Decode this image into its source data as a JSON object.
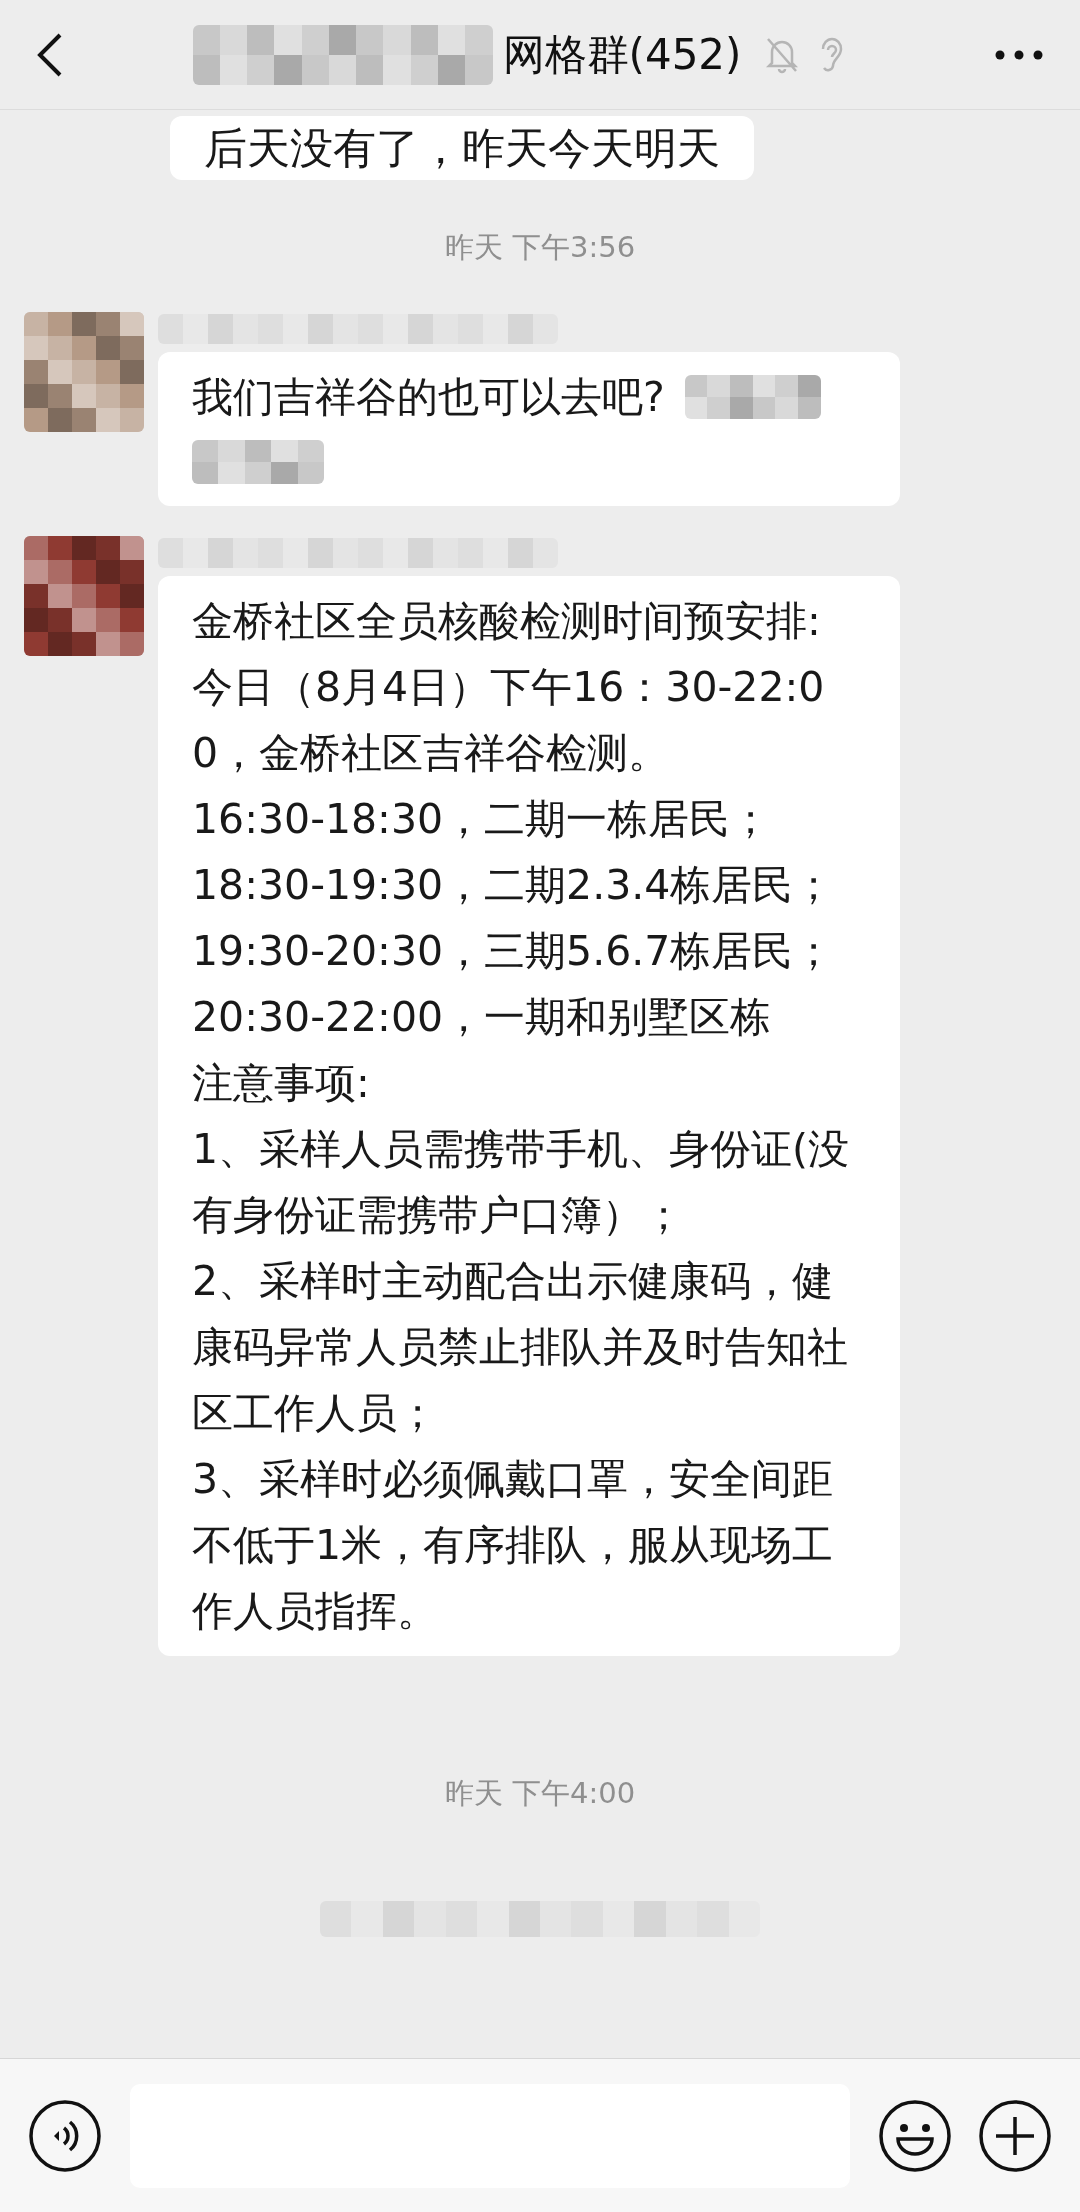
{
  "header": {
    "title": "网格群(452)"
  },
  "messages": [
    {
      "kind": "partial",
      "lines": [
        "后天没有了，昨天今天明天"
      ]
    },
    {
      "kind": "time",
      "text": "昨天 下午3:56"
    },
    {
      "kind": "text",
      "color": "#b59a86",
      "lines": [
        "我们吉祥谷的也可以去吧?"
      ]
    },
    {
      "kind": "text",
      "color": "#8f3a32",
      "lines": [
        "金桥社区全员核酸检测时间预安排:",
        "今日（8月4日）下午16：30-22:00，金桥社区吉祥谷检测。",
        "16:30-18:30，二期一栋居民；",
        "18:30-19:30，二期2.3.4栋居民；",
        "19:30-20:30，三期5.6.7栋居民；",
        "20:30-22:00，一期和别墅区栋",
        "注意事项:",
        "1、采样人员需携带手机、身份证(没有身份证需携带户口簿）；",
        "2、采样时主动配合出示健康码，健康码异常人员禁止排队并及时告知社区工作人员；",
        "3、采样时必须佩戴口罩，安全间距不低于1米，有序排队，服从现场工作人员指挥。"
      ]
    },
    {
      "kind": "time",
      "text": "昨天 下午4:00"
    },
    {
      "kind": "system"
    }
  ]
}
